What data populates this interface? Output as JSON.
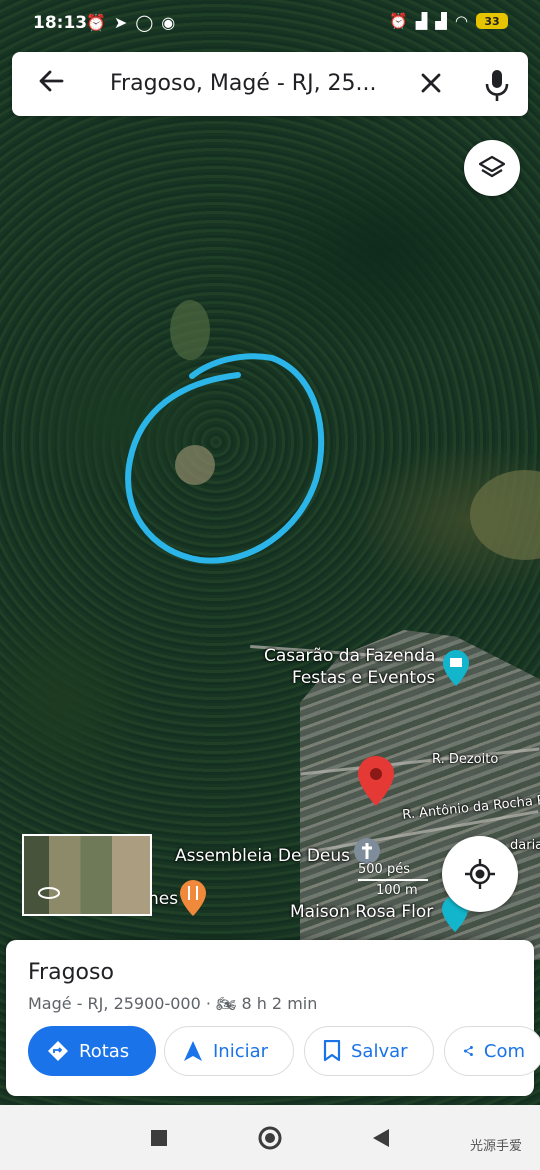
{
  "status_bar": {
    "time": "18:13",
    "battery": "33"
  },
  "search": {
    "query": "Fragoso, Magé - RJ, 25..."
  },
  "map": {
    "labels": {
      "venue_line1": "Casarão da Fazenda",
      "venue_line2": "Festas e Eventos",
      "street1": "R. Dezoito",
      "street2": "R. Antônio da Rocha Pa",
      "street3": "daria",
      "church": "Assembleia De Deus",
      "restaurant_partial": "nes",
      "shop": "Maison Rosa Flor"
    },
    "scale": {
      "feet": "500 pés",
      "meters": "100 m"
    },
    "annotation_color": "#2bb5e8",
    "pin_color": "#e53935"
  },
  "place_card": {
    "title": "Fragoso",
    "subtitle": "Magé - RJ, 25900-000 · ",
    "travel_time": "8 h 2 min",
    "buttons": {
      "directions": "Rotas",
      "start": "Iniciar",
      "save": "Salvar",
      "share": "Com"
    }
  },
  "watermark": "光源手爱",
  "colors": {
    "accent": "#1a73e8",
    "card_bg": "#ffffff"
  }
}
